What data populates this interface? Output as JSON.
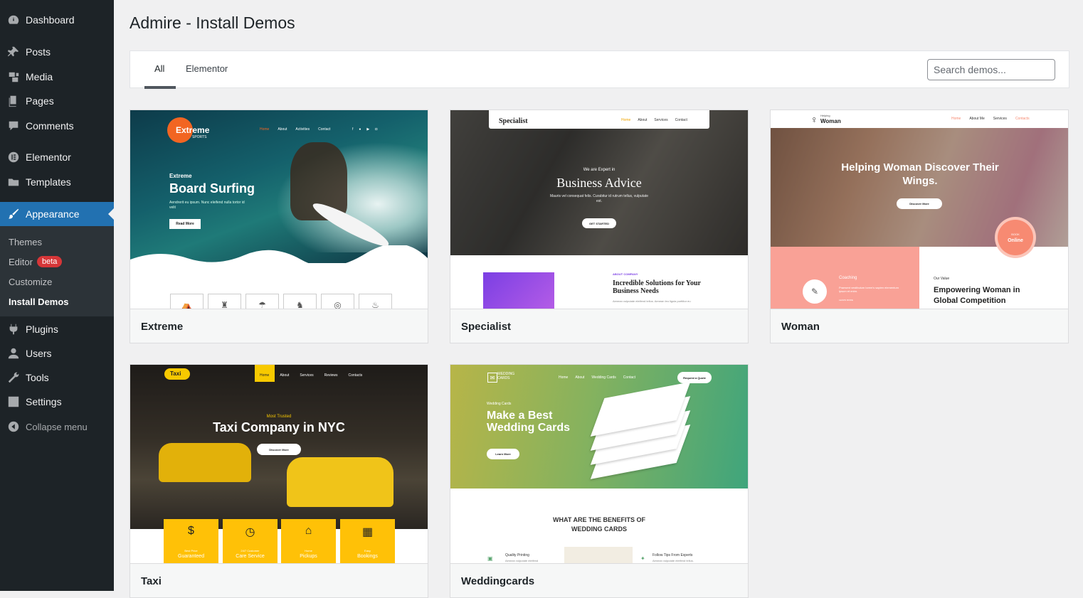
{
  "sidebar": {
    "items": [
      {
        "label": "Dashboard",
        "icon": "dashboard-icon"
      },
      {
        "label": "Posts",
        "icon": "pin-icon"
      },
      {
        "label": "Media",
        "icon": "media-icon"
      },
      {
        "label": "Pages",
        "icon": "pages-icon"
      },
      {
        "label": "Comments",
        "icon": "comment-icon"
      },
      {
        "label": "Elementor",
        "icon": "elementor-icon"
      },
      {
        "label": "Templates",
        "icon": "folder-icon"
      },
      {
        "label": "Appearance",
        "icon": "brush-icon"
      },
      {
        "label": "Plugins",
        "icon": "plugin-icon"
      },
      {
        "label": "Users",
        "icon": "user-icon"
      },
      {
        "label": "Tools",
        "icon": "wrench-icon"
      },
      {
        "label": "Settings",
        "icon": "settings-icon"
      }
    ],
    "submenu": {
      "themes": "Themes",
      "editor": "Editor",
      "editor_badge": "beta",
      "customize": "Customize",
      "install_demos": "Install Demos"
    },
    "collapse": "Collapse menu",
    "active_color": "#2271b1"
  },
  "page": {
    "title": "Admire - Install Demos"
  },
  "filters": {
    "tabs": [
      "All",
      "Elementor"
    ],
    "active_tab": "All",
    "search_placeholder": "Search demos..."
  },
  "demos": [
    {
      "name": "Extreme",
      "preview": {
        "logo": "Extreme",
        "logo_sub": "SPORTS",
        "nav": [
          "Home",
          "About",
          "Activities",
          "Contact"
        ],
        "eyebrow": "Extreme",
        "headline": "Board Surfing",
        "body": "Aendrerit eu ipsum. Nunc eleifend nulla tortor id velit",
        "cta": "Read More"
      }
    },
    {
      "name": "Specialist",
      "preview": {
        "logo": "Specialist",
        "nav": [
          "Home",
          "About",
          "Services",
          "Contact"
        ],
        "eyebrow": "We are Expert in",
        "headline": "Business Advice",
        "body": "Mauris vel consequat felis. Curabitur id rutrum tellus, vulputate est.",
        "cta": "GET STARTED",
        "section_eyebrow": "ABOUT COMPANY",
        "section_headline": "Incredible Solutions for Your Business Needs",
        "section_body": "Aenean vulputate eleifend tellus. Aenean leo ligula porttitor eu"
      }
    },
    {
      "name": "Woman",
      "preview": {
        "logo_small": "Helping",
        "logo": "Woman",
        "nav": [
          "Home",
          "About Me",
          "Services",
          "Contacts"
        ],
        "headline": "Helping Woman Discover Their Wings.",
        "cta": "Discover More",
        "badge_top": "BOOK",
        "badge_bottom": "Online",
        "card_title": "Coaching",
        "card_body": "Praesent vestibulum lorem's sapien elementum ipsum et enim.",
        "card_link": "LEARN MORE",
        "section_eyebrow": "Our Value",
        "section_headline": "Empowering Woman in Global Competition"
      }
    },
    {
      "name": "Taxi",
      "preview": {
        "logo": "Taxi",
        "nav": [
          "Home",
          "About",
          "Services",
          "Reviews",
          "Contacts"
        ],
        "eyebrow": "Most Trusted",
        "headline": "Taxi Company in NYC",
        "cta": "Discover More",
        "features": [
          {
            "top": "Best Price",
            "bottom": "Guaranteed"
          },
          {
            "top": "24/7 Customer",
            "bottom": "Care Service"
          },
          {
            "top": "Home",
            "bottom": "Pickups"
          },
          {
            "top": "Easy",
            "bottom": "Bookings"
          }
        ]
      }
    },
    {
      "name": "Weddingcards",
      "preview": {
        "logo": "WEDDING CARDS",
        "nav": [
          "Home",
          "About",
          "Wedding Cards",
          "Contact"
        ],
        "quote_btn": "Request a Quote",
        "eyebrow": "Wedding Cards",
        "headline": "Make a Best Wedding Cards",
        "cta": "Learn More",
        "section_headline": "WHAT ARE THE BENEFITS OF WEDDING CARDS",
        "benefit_1_title": "Quality Printing",
        "benefit_1_body": "Aenean vulputate eleifend",
        "benefit_2_title": "Follow Tips From Experts",
        "benefit_2_body": "Aenean vulputate eleifend tellus."
      }
    }
  ]
}
